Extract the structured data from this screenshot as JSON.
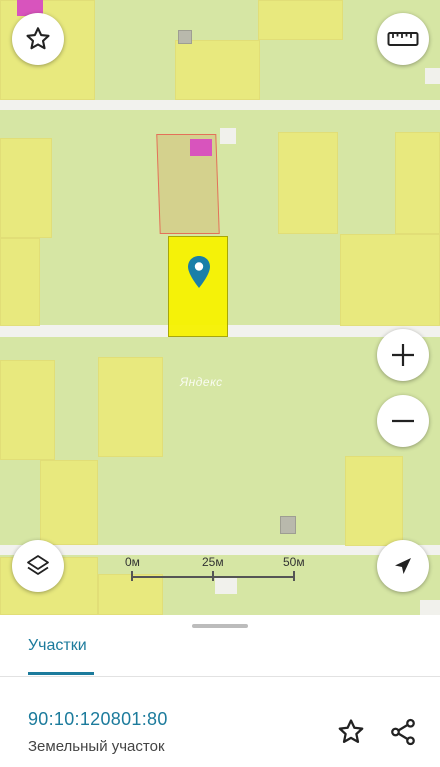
{
  "map": {
    "watermark": "Яндекс",
    "scale": {
      "labels": [
        "0м",
        "25м",
        "50м"
      ]
    }
  },
  "controls": {
    "favorite_icon": "star-outline-icon",
    "ruler_icon": "ruler-icon",
    "zoom_in_icon": "plus-icon",
    "zoom_out_icon": "minus-icon",
    "layers_icon": "layers-icon",
    "location_icon": "navigation-arrow-icon"
  },
  "sheet": {
    "tab_label": "Участки",
    "cadastral_number": "90:10:120801:80",
    "object_type": "Земельный участок",
    "favorite_icon": "star-outline-icon",
    "share_icon": "share-icon"
  },
  "colors": {
    "accent": "#1c7b9c",
    "selected_parcel": "#f7f300",
    "parcel": "#e9ea7c",
    "map_bg": "#d6e6a4",
    "marker": "#1a7fa8"
  }
}
